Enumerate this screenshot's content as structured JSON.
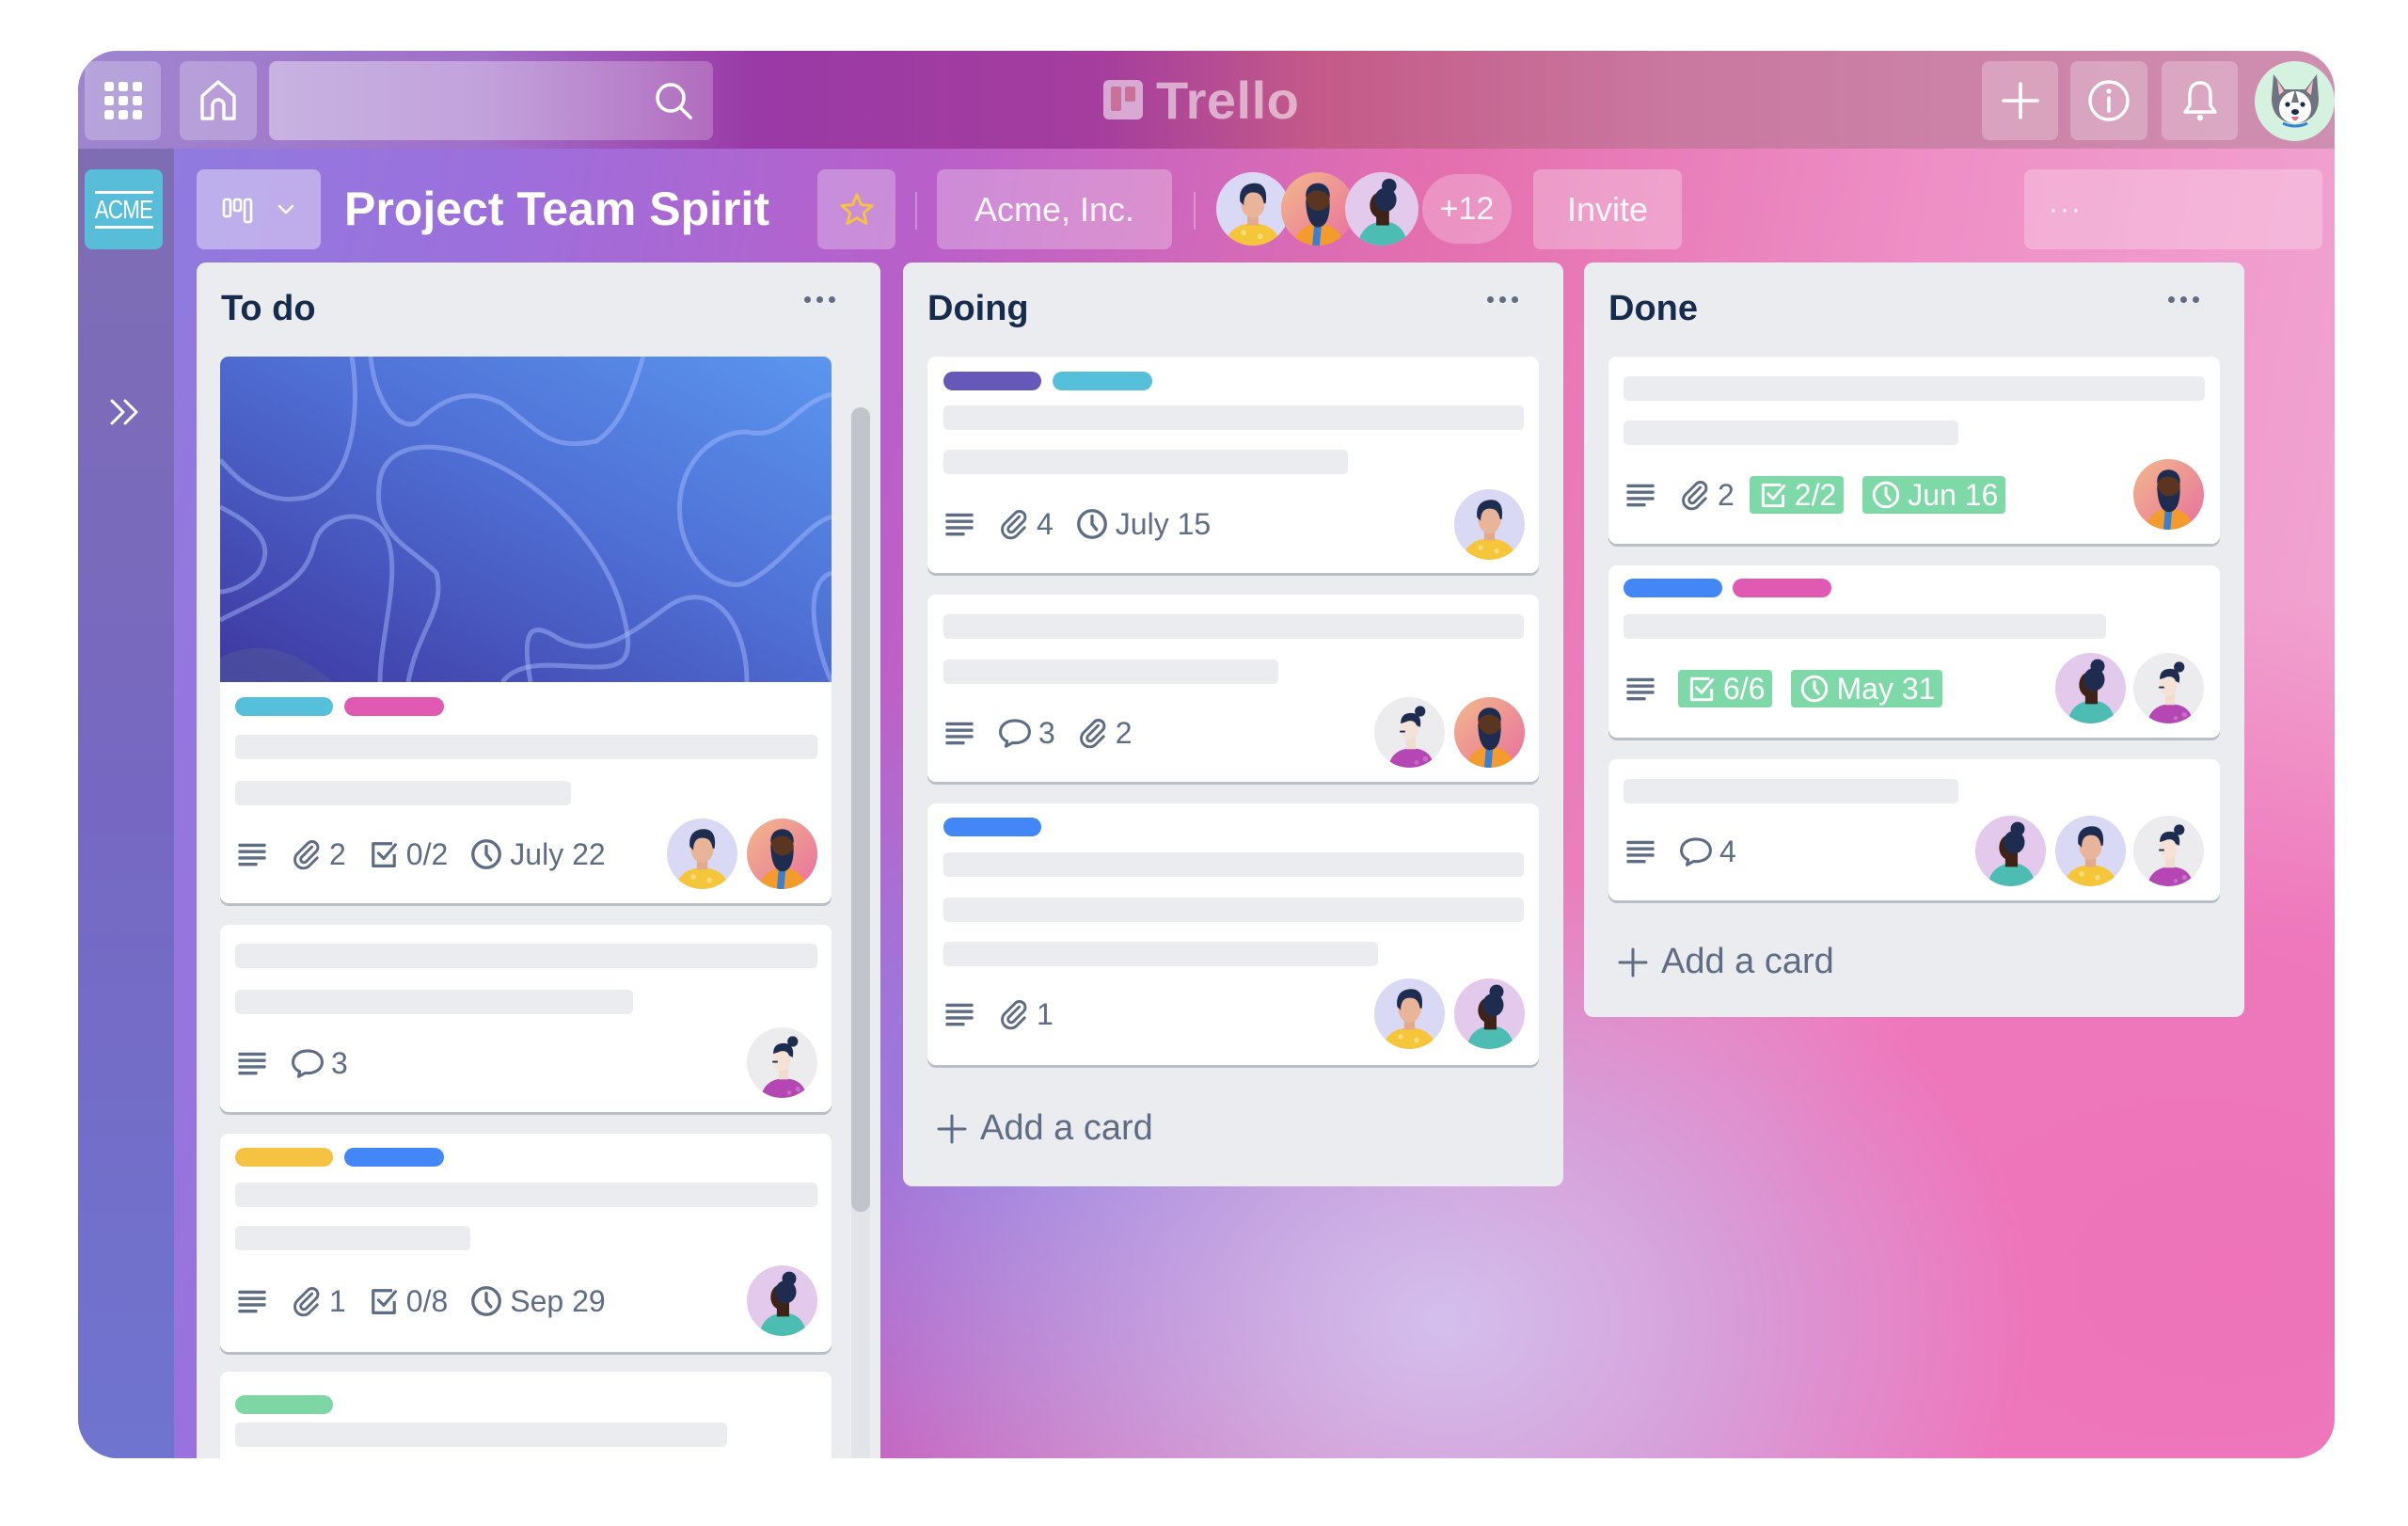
{
  "app": {
    "logo_text": "Trello"
  },
  "topbar": {
    "apps_icon": "grid-icon",
    "home_icon": "home-icon",
    "search": {
      "value": "",
      "placeholder": "",
      "icon": "search-icon"
    },
    "create_icon": "plus-icon",
    "info_icon": "info-icon",
    "notifications_icon": "bell-icon",
    "user_avatar": "husky-avatar"
  },
  "sidebar": {
    "workspace_logo_text": "ACME",
    "expand_icon": "double-chevron-right-icon"
  },
  "board_header": {
    "view_switcher_icon": "board-view-icon",
    "view_switcher_chevron": "chevron-down-icon",
    "title": "Project Team Spirit",
    "star_icon": "star-icon",
    "workspace_label": "Acme, Inc.",
    "members": [
      {
        "name": "member-yellow-shirt"
      },
      {
        "name": "member-bearded"
      },
      {
        "name": "member-teal-sweater"
      }
    ],
    "more_members_count": "+12",
    "invite_label": "Invite",
    "menu_label": "···",
    "accent_star_color": "#f5c242"
  },
  "lists": [
    {
      "title": "To do",
      "menu": "···",
      "cards": [
        {
          "cover": true,
          "labels": [
            "#56bfd9",
            "#e05ab3"
          ],
          "meta": {
            "attachments": "2",
            "checklist": "0/2",
            "due": "July 22"
          },
          "members": [
            "member-yellow-shirt",
            "member-bearded"
          ]
        },
        {
          "labels": [],
          "meta": {
            "comments": "3"
          },
          "members": [
            "member-bun-purple"
          ]
        },
        {
          "labels": [
            "#f5c242",
            "#4287f5"
          ],
          "meta": {
            "attachments": "1",
            "checklist": "0/8",
            "due": "Sep 29"
          },
          "members": [
            "member-teal-sweater"
          ]
        },
        {
          "labels": [
            "#7ed6a4"
          ]
        }
      ]
    },
    {
      "title": "Doing",
      "menu": "···",
      "cards": [
        {
          "labels": [
            "#6558b8",
            "#56bfd9"
          ],
          "meta": {
            "attachments": "4",
            "due": "July 15"
          },
          "members": [
            "member-yellow-shirt"
          ]
        },
        {
          "labels": [],
          "meta": {
            "comments": "3",
            "attachments": "2"
          },
          "members": [
            "member-bun-purple",
            "member-bearded"
          ]
        },
        {
          "labels": [
            "#4287f5"
          ],
          "meta": {
            "attachments": "1"
          },
          "members": [
            "member-yellow-shirt",
            "member-teal-sweater"
          ]
        }
      ],
      "add_card_label": "Add a card"
    },
    {
      "title": "Done",
      "menu": "···",
      "cards": [
        {
          "labels": [],
          "meta": {
            "attachments": "2",
            "checklist": "2/2",
            "due": "Jun 16"
          },
          "members": [
            "member-bearded"
          ]
        },
        {
          "labels": [
            "#4287f5",
            "#e05ab3"
          ],
          "meta": {
            "checklist": "6/6",
            "due": "May 31"
          },
          "members": [
            "member-teal-sweater",
            "member-bun-purple"
          ]
        },
        {
          "labels": [],
          "meta": {
            "comments": "4"
          },
          "members": [
            "member-teal-sweater",
            "member-yellow-shirt",
            "member-bun-purple"
          ]
        }
      ],
      "add_card_label": "Add a card"
    }
  ],
  "colors": {
    "complete_badge": "#7fd8a8",
    "list_bg": "#ebecf0",
    "list_title": "#172b4d",
    "meta_text": "#5e6c84"
  }
}
